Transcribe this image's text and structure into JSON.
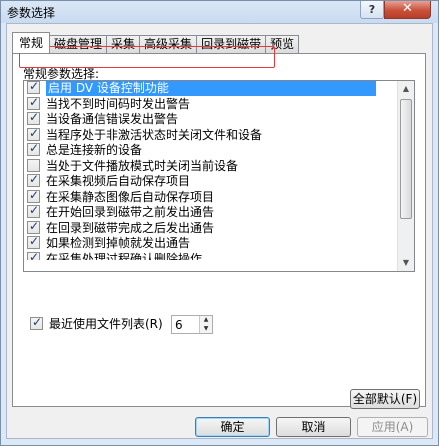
{
  "window": {
    "title": "参数选择"
  },
  "titlebar": {
    "help": "?",
    "close": "✕"
  },
  "tabs": [
    {
      "label": "常规",
      "active": true
    },
    {
      "label": "磁盘管理",
      "active": false
    },
    {
      "label": "采集",
      "active": false
    },
    {
      "label": "高级采集",
      "active": false
    },
    {
      "label": "回录到磁带",
      "active": false
    },
    {
      "label": "预览",
      "active": false
    }
  ],
  "general": {
    "group_label": "常规参数选择:",
    "options": [
      {
        "label": "启用 DV 设备控制功能",
        "checked": true,
        "selected": true
      },
      {
        "label": "当找不到时间码时发出警告",
        "checked": true,
        "selected": false
      },
      {
        "label": "当设备通信错误发出警告",
        "checked": true,
        "selected": false
      },
      {
        "label": "当程序处于非激活状态时关闭文件和设备",
        "checked": true,
        "selected": false
      },
      {
        "label": "总是连接新的设备",
        "checked": true,
        "selected": false
      },
      {
        "label": "当处于文件播放模式时关闭当前设备",
        "checked": false,
        "selected": false
      },
      {
        "label": "在采集视频后自动保存项目",
        "checked": true,
        "selected": false
      },
      {
        "label": "在采集静态图像后自动保存项目",
        "checked": true,
        "selected": false
      },
      {
        "label": "在开始回录到磁带之前发出通告",
        "checked": true,
        "selected": false
      },
      {
        "label": "在回录到磁带完成之后发出通告",
        "checked": true,
        "selected": false
      },
      {
        "label": "如果检测到掉帧就发出通告",
        "checked": true,
        "selected": false
      },
      {
        "label": "在采集处理过程确认删除操作",
        "checked": true,
        "selected": false
      }
    ],
    "recent_files": {
      "label": "最近使用文件列表(R)",
      "checked": true,
      "value": "6"
    },
    "reset_all": "全部默认(F)"
  },
  "footer": {
    "ok": "确定",
    "cancel": "取消",
    "apply": "应用(A)"
  }
}
